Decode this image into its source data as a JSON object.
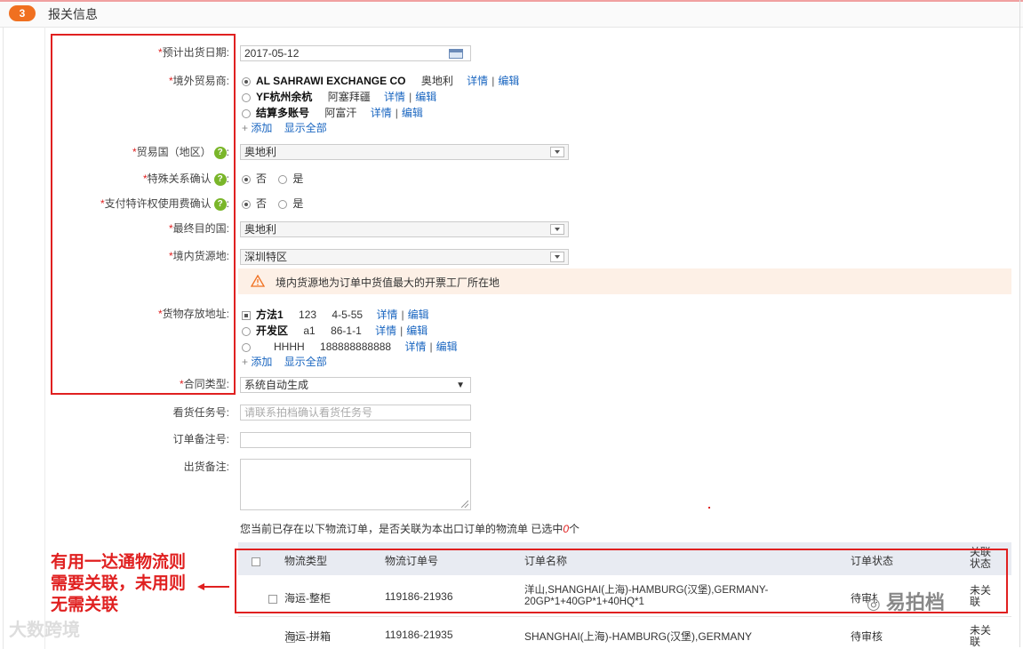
{
  "section": {
    "step": "3",
    "title": "报关信息"
  },
  "fields": {
    "ship_date": {
      "label": "预计出货日期",
      "value": "2017-05-12"
    },
    "trader": {
      "label": "境外贸易商",
      "items": [
        {
          "name": "AL SAHRAWI EXCHANGE CO",
          "country": "奥地利",
          "detail": "详情",
          "edit": "编辑",
          "selected": true
        },
        {
          "name": "YF杭州余杭",
          "country": "阿塞拜疆",
          "detail": "详情",
          "edit": "编辑",
          "selected": false
        },
        {
          "name": "结算多账号",
          "country": "阿富汗",
          "detail": "详情",
          "edit": "编辑",
          "selected": false
        }
      ],
      "add": "添加",
      "show_all": "显示全部"
    },
    "trade_country": {
      "label": "贸易国（地区）",
      "value": "奥地利"
    },
    "special_relation": {
      "label": "特殊关系确认",
      "no": "否",
      "yes": "是"
    },
    "royalty": {
      "label": "支付特许权使用费确认",
      "no": "否",
      "yes": "是"
    },
    "destination": {
      "label": "最终目的国",
      "value": "奥地利"
    },
    "source": {
      "label": "境内货源地",
      "value": "深圳特区"
    },
    "source_notice": "境内货源地为订单中货值最大的开票工厂所在地",
    "storage": {
      "label": "货物存放地址",
      "items": [
        {
          "name": "方法1",
          "code": "123",
          "addr": "4-5-55",
          "detail": "详情",
          "edit": "编辑",
          "selected": true
        },
        {
          "name": "开发区",
          "code": "a1",
          "addr": "86-1-1",
          "detail": "详情",
          "edit": "编辑",
          "selected": false
        },
        {
          "name": "HHHH",
          "code": "188888888888",
          "addr": "",
          "detail": "详情",
          "edit": "编辑",
          "selected": false
        }
      ],
      "add": "添加",
      "show_all": "显示全部"
    },
    "contract_type": {
      "label": "合同类型",
      "value": "系统自动生成"
    },
    "inspection_no": {
      "label": "看货任务号",
      "placeholder": "请联系拍档确认看货任务号"
    },
    "order_remark_no": {
      "label": "订单备注号",
      "value": ""
    },
    "ship_remark": {
      "label": "出货备注",
      "value": ""
    }
  },
  "logistics": {
    "prompt_pre": "您当前已存在以下物流订单，是否关联为本出口订单的物流单 已选中",
    "selected_count": "0",
    "prompt_post": "个",
    "headers": {
      "type": "物流类型",
      "order_no": "物流订单号",
      "order_name": "订单名称",
      "status": "订单状态",
      "link_status": "关联状态"
    },
    "rows": [
      {
        "type": "海运-整柜",
        "order_no": "119186-21936",
        "order_name": "洋山,SHANGHAI(上海)-HAMBURG(汉堡),GERMANY-20GP*1+40GP*1+40HQ*1",
        "status": "待审核",
        "link": "未关联"
      },
      {
        "type": "海运-拼箱",
        "order_no": "119186-21935",
        "order_name": "SHANGHAI(上海)-HAMBURG(汉堡),GERMANY",
        "status": "待审核",
        "link": "未关联"
      }
    ]
  },
  "annotation": {
    "text": "有用一达通物流则需要关联，未用则无需关联",
    "color": "#e02020"
  },
  "brand": {
    "logo_text": "易拍档",
    "watermark": "大数跨境"
  },
  "colors": {
    "accent": "#f07020",
    "link": "#1a66c0",
    "required": "#e02020",
    "help": "#7ab62a"
  }
}
